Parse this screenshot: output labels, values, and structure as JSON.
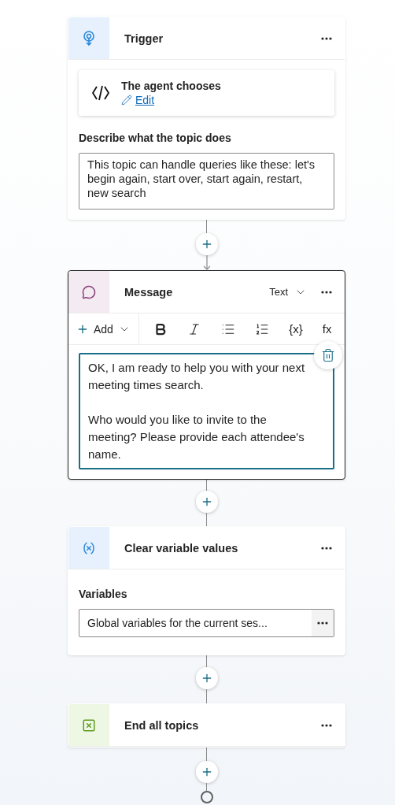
{
  "nodes": [
    {
      "kind": "trigger",
      "title": "Trigger",
      "selected": false,
      "agent_card": {
        "title": "The agent chooses",
        "link": "Edit"
      },
      "description_label": "Describe what the topic does",
      "description": "This topic can handle queries like these: let's begin again, start over, start again, restart, new search"
    },
    {
      "kind": "message",
      "title": "Message",
      "selected": true,
      "format": "Text",
      "add_label": "Add",
      "tools": [
        {
          "kind": "bold"
        },
        {
          "kind": "italic"
        },
        {
          "kind": "bullets"
        },
        {
          "kind": "numbers"
        },
        {
          "kind": "text",
          "label": "{x}"
        },
        {
          "kind": "text",
          "label": "fx"
        }
      ],
      "text": "OK, I am ready to help you with your next meeting times search.\n\nWho would you like to invite to the meeting? Please provide each attendee's name."
    },
    {
      "kind": "clear_variables",
      "title": "Clear variable values",
      "selected": false,
      "field_label": "Variables",
      "field_value": "Global variables for the current ses..."
    },
    {
      "kind": "end",
      "title": "End all topics",
      "selected": false
    }
  ]
}
